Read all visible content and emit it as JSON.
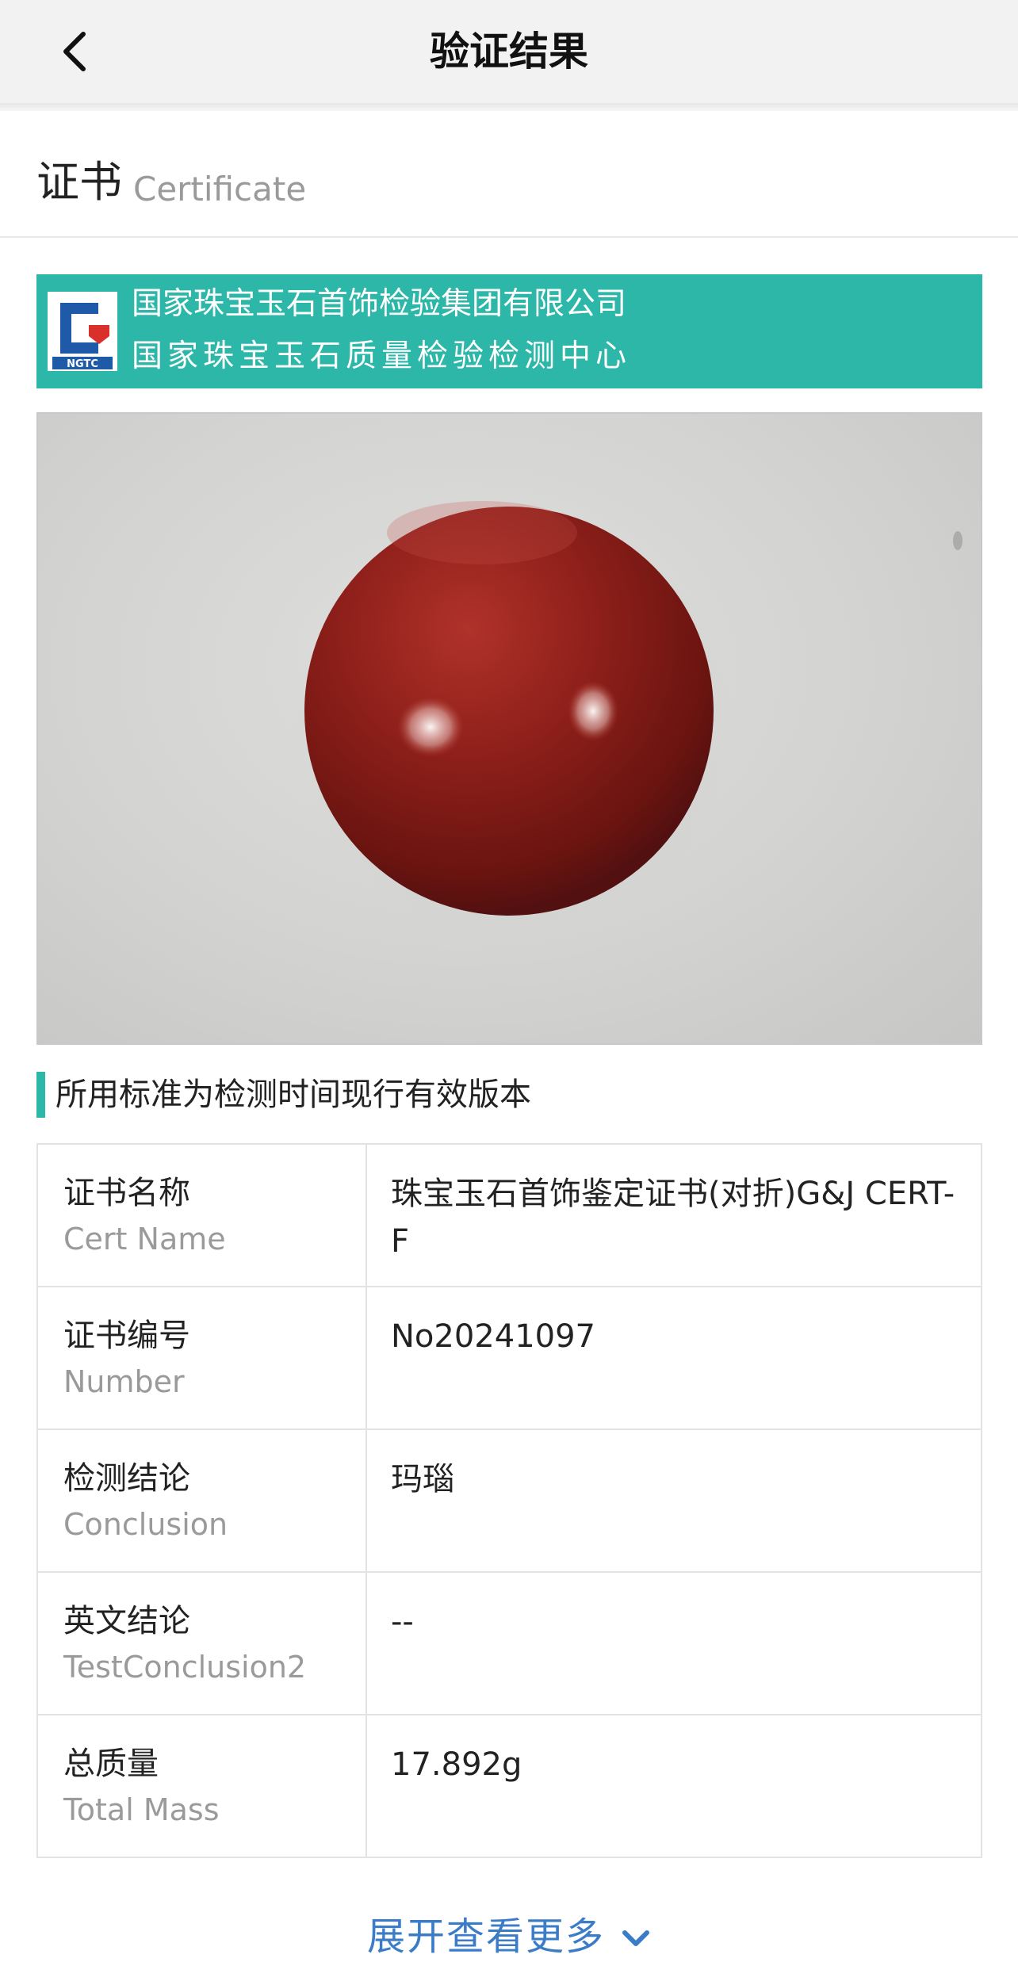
{
  "nav": {
    "title": "验证结果",
    "back_icon": "chevron-left-icon"
  },
  "section": {
    "title": "证书",
    "subtitle": "Certificate"
  },
  "issuer": {
    "logo_text": "NGTC",
    "name_line1": "国家珠宝玉石首饰检验集团有限公司",
    "name_line2": "国家珠宝玉石质量检验检测中心",
    "brand_color": "#2cb7a8"
  },
  "note": "所用标准为检测时间现行有效版本",
  "details": [
    {
      "label_zh": "证书名称",
      "label_en": "Cert Name",
      "value": "珠宝玉石首饰鉴定证书(对折)G&J CERT-F"
    },
    {
      "label_zh": "证书编号",
      "label_en": "Number",
      "value": "No20241097"
    },
    {
      "label_zh": "检测结论",
      "label_en": "Conclusion",
      "value": "玛瑙"
    },
    {
      "label_zh": "英文结论",
      "label_en": "TestConclusion2",
      "value": "--"
    },
    {
      "label_zh": "总质量",
      "label_en": "Total Mass",
      "value": "17.892g"
    }
  ],
  "expand": {
    "label": "展开查看更多",
    "icon": "chevron-down-icon",
    "color": "#3a7cc7"
  }
}
